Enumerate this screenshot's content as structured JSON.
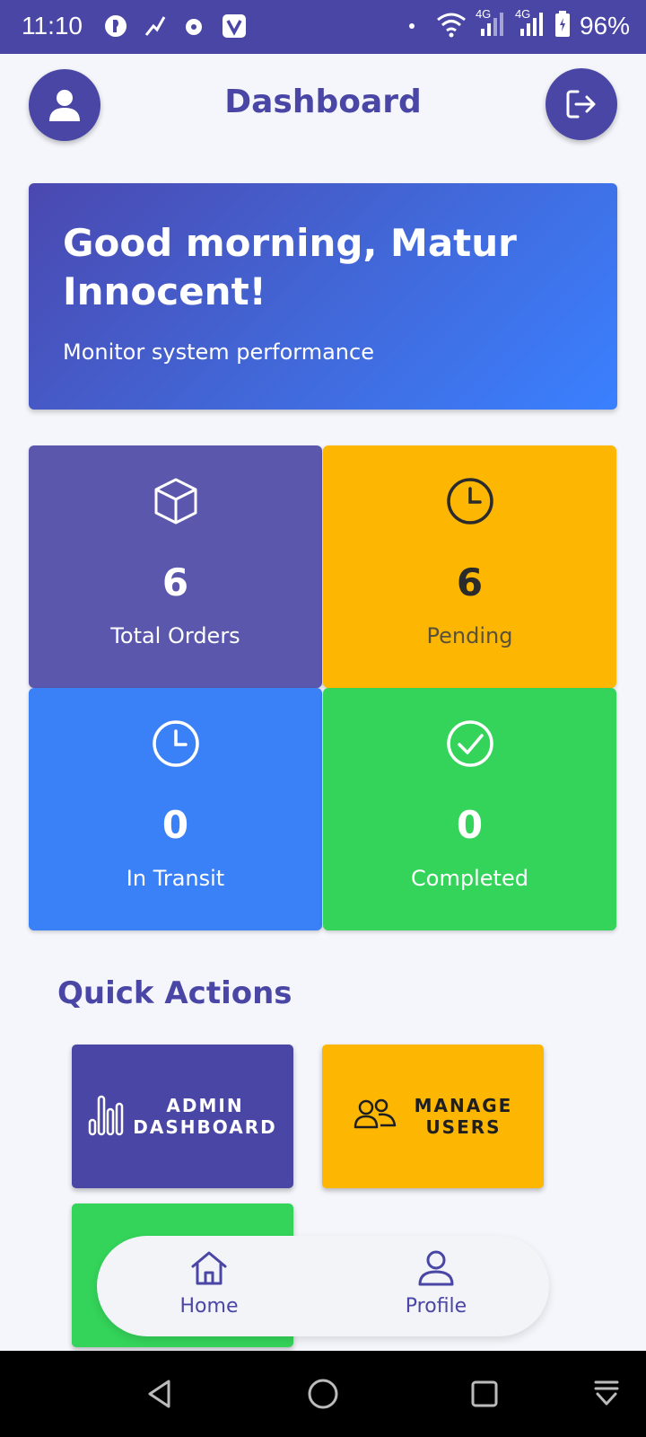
{
  "status_bar": {
    "time": "11:10",
    "battery": "96%",
    "network_1": "4G",
    "network_2": "4G"
  },
  "header": {
    "title": "Dashboard"
  },
  "greeting": {
    "title": "Good morning, Matur Innocent!",
    "subtitle": "Monitor system performance"
  },
  "stats": [
    {
      "value": "6",
      "label": "Total Orders",
      "icon": "box-icon",
      "color": "#5b57ad"
    },
    {
      "value": "6",
      "label": "Pending",
      "icon": "clock-icon",
      "color": "#fdb702"
    },
    {
      "value": "0",
      "label": "In Transit",
      "icon": "clock-icon",
      "color": "#3a80f6"
    },
    {
      "value": "0",
      "label": "Completed",
      "icon": "check-circle-icon",
      "color": "#34d45a"
    }
  ],
  "quick_actions": {
    "title": "Quick Actions",
    "items": [
      {
        "label_line1": "ADMIN",
        "label_line2": "DASHBOARD",
        "icon": "bar-chart-icon",
        "color": "#4a46a6"
      },
      {
        "label_line1": "MANAGE",
        "label_line2": "USERS",
        "icon": "users-icon",
        "color": "#fdb702"
      },
      {
        "label_line1": "",
        "label_line2": "",
        "icon": "",
        "color": "#34d45a"
      }
    ]
  },
  "bottom_nav": {
    "items": [
      {
        "label": "Home",
        "icon": "home-icon"
      },
      {
        "label": "Profile",
        "icon": "user-icon"
      }
    ]
  },
  "colors": {
    "primary": "#4a46a6",
    "background": "#f5f6fb"
  }
}
